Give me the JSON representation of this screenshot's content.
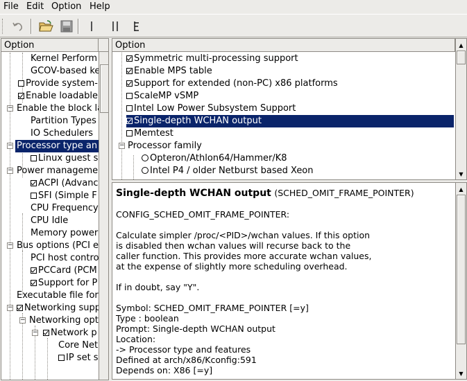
{
  "menubar": {
    "file": "File",
    "edit": "Edit",
    "option": "Option",
    "help": "Help"
  },
  "toolbar": {
    "icons": [
      "undo-icon",
      "open-folder-icon",
      "save-disk-icon",
      "single-view-icon",
      "split-view-icon",
      "full-view-icon"
    ]
  },
  "left_tree": {
    "header": "Option",
    "items": [
      {
        "label": "Kernel Perform",
        "check": "none"
      },
      {
        "label": "GCOV-based ke",
        "check": "none"
      },
      {
        "label": "Provide system-",
        "check": "off"
      },
      {
        "label": "Enable loadable",
        "check": "on"
      },
      {
        "label": "Enable the block la",
        "check": "none"
      },
      {
        "label": "Partition Types",
        "check": "none"
      },
      {
        "label": "IO Schedulers",
        "check": "none"
      },
      {
        "label": "Processor type an",
        "check": "none",
        "selected": true
      },
      {
        "label": "Linux guest s",
        "check": "off"
      },
      {
        "label": "Power manageme",
        "check": "none"
      },
      {
        "label": "ACPI (Advanc",
        "check": "on"
      },
      {
        "label": "SFI (Simple F",
        "check": "off"
      },
      {
        "label": "CPU Frequency",
        "check": "none"
      },
      {
        "label": "CPU Idle",
        "check": "none"
      },
      {
        "label": "Memory power",
        "check": "none"
      },
      {
        "label": "Bus options (PCI e",
        "check": "none"
      },
      {
        "label": "PCI host contro",
        "check": "none"
      },
      {
        "label": "PCCard (PCM",
        "check": "on"
      },
      {
        "label": "Support for P",
        "check": "on"
      },
      {
        "label": "Executable file form",
        "check": "none"
      },
      {
        "label": "Networking supp",
        "check": "on"
      },
      {
        "label": "Networking opt",
        "check": "none"
      },
      {
        "label": "Network p",
        "check": "on"
      },
      {
        "label": "Core Net",
        "check": "none"
      },
      {
        "label": "IP set s",
        "check": "off"
      }
    ]
  },
  "right_list": {
    "header": "Option",
    "items": [
      {
        "label": "Symmetric multi-processing support",
        "check": "on"
      },
      {
        "label": "Enable MPS table",
        "check": "on"
      },
      {
        "label": "Support for extended (non-PC) x86 platforms",
        "check": "on"
      },
      {
        "label": "ScaleMP vSMP",
        "check": "off"
      },
      {
        "label": "Intel Low Power Subsystem Support",
        "check": "off"
      },
      {
        "label": "Single-depth WCHAN output",
        "check": "on",
        "selected": true
      },
      {
        "label": "Memtest",
        "check": "off"
      },
      {
        "label": "Processor family",
        "check": "none"
      },
      {
        "label": "Opteron/Athlon64/Hammer/K8",
        "check": "radio"
      },
      {
        "label": "Intel P4 / older Netburst based Xeon",
        "check": "radio"
      }
    ]
  },
  "help": {
    "title": "Single-depth WCHAN output",
    "symbol_paren": "(SCHED_OMIT_FRAME_POINTER)",
    "config": "CONFIG_SCHED_OMIT_FRAME_POINTER:",
    "desc1": "Calculate simpler /proc/<PID>/wchan values. If this option",
    "desc2": "is disabled then wchan values will recurse back to the",
    "desc3": "caller function. This provides more accurate wchan values,",
    "desc4": "at the expense of slightly more scheduling overhead.",
    "doubt": "If in doubt, say \"Y\".",
    "symbol": "Symbol: SCHED_OMIT_FRAME_POINTER [=y]",
    "type": "Type  : boolean",
    "prompt": "Prompt: Single-depth WCHAN output",
    "location": "  Location:",
    "loc_path": "    -> Processor type and features",
    "defined": "  Defined at arch/x86/Kconfig:591",
    "depends": "  Depends on: X86 [=y]"
  }
}
